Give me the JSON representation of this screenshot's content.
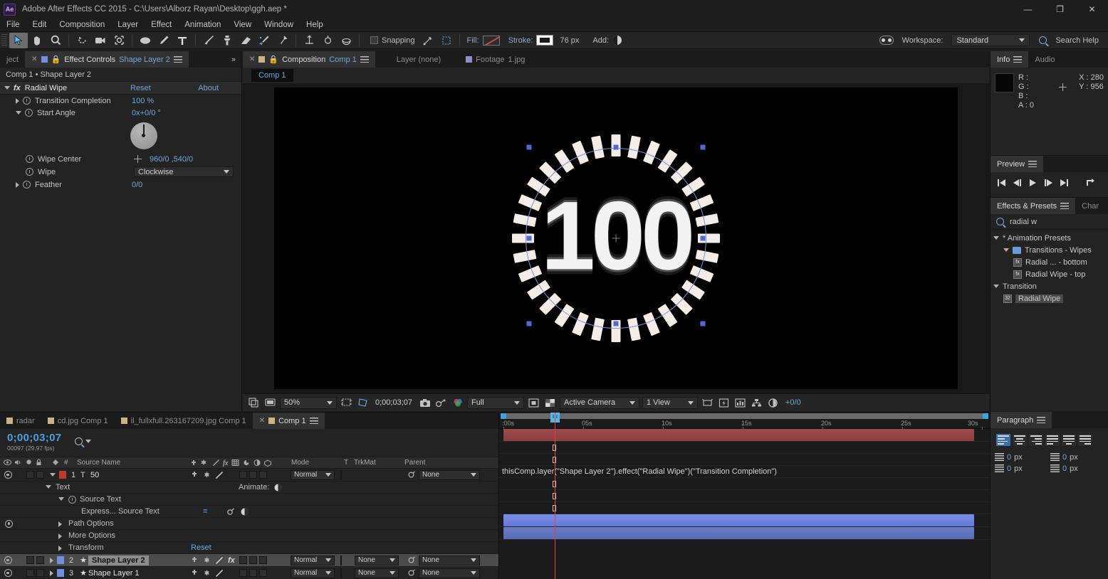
{
  "titlebar": {
    "logo": "Ae",
    "title": "Adobe After Effects CC 2015 - C:\\Users\\Alborz Rayan\\Desktop\\ggh.aep *",
    "minimize": "—",
    "maximize": "❐",
    "close": "✕"
  },
  "menu": [
    "File",
    "Edit",
    "Composition",
    "Layer",
    "Effect",
    "Animation",
    "View",
    "Window",
    "Help"
  ],
  "toolbar": {
    "snapping_label": "Snapping",
    "fill_label": "Fill:",
    "stroke_label": "Stroke:",
    "stroke_width": "76 px",
    "add_label": "Add:",
    "workspace_label": "Workspace:",
    "workspace_value": "Standard",
    "search_help": "Search Help"
  },
  "effect_controls": {
    "tab_project": "ject",
    "tab_title": "Effect Controls",
    "tab_subject": "Shape Layer 2",
    "breadcrumb": "Comp 1 • Shape Layer 2",
    "effect_name": "Radial Wipe",
    "reset": "Reset",
    "about": "About",
    "properties": [
      {
        "label": "Transition Completion",
        "value": "100 %"
      },
      {
        "label": "Start Angle",
        "value": "0x+0/0 °"
      },
      {
        "label": "Wipe Center",
        "value": "960/0 ,540/0"
      },
      {
        "label": "Wipe",
        "value": "Clockwise"
      },
      {
        "label": "Feather",
        "value": "0/0"
      }
    ]
  },
  "viewer": {
    "tabs": [
      {
        "label": "Composition",
        "value": "Comp 1",
        "active": true
      },
      {
        "label": "Layer (none)",
        "value": "",
        "active": false
      },
      {
        "label": "Footage",
        "value": "1.jpg",
        "active": false
      }
    ],
    "subtab": "Comp 1",
    "canvas_text": "100",
    "bottom": {
      "zoom": "50%",
      "time": "0;00;03;07",
      "quality": "Full",
      "camera": "Active Camera",
      "views": "1 View",
      "exposure": "+0/0"
    }
  },
  "info": {
    "tab": "Info",
    "tab2": "Audio",
    "r": "R :",
    "g": "G :",
    "b": "B :",
    "a": "A : 0",
    "x": "X : 280",
    "y": "Y : 956"
  },
  "preview": {
    "tab": "Preview"
  },
  "effects_presets": {
    "tab": "Effects & Presets",
    "tab2": "Char",
    "search_value": "radial w",
    "tree": [
      {
        "label": "* Animation Presets",
        "type": "group",
        "indent": 0
      },
      {
        "label": "Transitions - Wipes",
        "type": "folder",
        "indent": 1
      },
      {
        "label": "Radial ... - bottom",
        "type": "preset",
        "indent": 2
      },
      {
        "label": "Radial Wipe - top",
        "type": "preset",
        "indent": 2
      },
      {
        "label": "Transition",
        "type": "group",
        "indent": 0
      },
      {
        "label": "Radial Wipe",
        "type": "effect",
        "indent": 1,
        "selected": true
      }
    ]
  },
  "timeline": {
    "tabs": [
      {
        "label": "radar",
        "active": false
      },
      {
        "label": "cd.jpg Comp 1",
        "active": false
      },
      {
        "label": "il_fullxfull.263167209.jpg Comp 1",
        "active": false
      },
      {
        "label": "Comp 1",
        "active": true
      }
    ],
    "current_time": "0;00;03;07",
    "frame_info": "00097 (29.97 fps)",
    "columns": {
      "num": "#",
      "source_name": "Source Name",
      "mode": "Mode",
      "t": "T",
      "trkmat": "TrkMat",
      "parent": "Parent"
    },
    "layers": [
      {
        "num": "1",
        "name": "50",
        "mode": "Normal",
        "trkmat": "",
        "parent": "None",
        "color": "#c0392b",
        "selected": false
      },
      {
        "num": "2",
        "name": "Shape Layer 2",
        "mode": "Normal",
        "trkmat": "None",
        "parent": "None",
        "color": "#6f8fe0",
        "selected": true
      },
      {
        "num": "3",
        "name": "Shape Layer 1",
        "mode": "Normal",
        "trkmat": "None",
        "parent": "None",
        "color": "#6f8fe0",
        "selected": false
      }
    ],
    "properties": [
      {
        "label": "Text",
        "extra": "Animate:",
        "indent": 1
      },
      {
        "label": "Source Text",
        "extra": "",
        "indent": 2
      },
      {
        "label": "Express... Source Text",
        "extra": "",
        "indent": 3
      },
      {
        "label": "Path Options",
        "extra": "",
        "indent": 2
      },
      {
        "label": "More Options",
        "extra": "",
        "indent": 2
      },
      {
        "label": "Transform",
        "extra": "Reset",
        "indent": 2
      }
    ],
    "expression": "thisComp.layer(\"Shape Layer 2\").effect(\"Radial Wipe\")(\"Transition Completion\")",
    "ruler_ticks": [
      ":00s",
      "05s",
      "10s",
      "15s",
      "20s",
      "25s",
      "30s"
    ]
  },
  "paragraph": {
    "tab": "Paragraph",
    "fields": [
      {
        "value": "0",
        "unit": "px"
      },
      {
        "value": "0",
        "unit": "px"
      },
      {
        "value": "0",
        "unit": "px"
      },
      {
        "value": "0",
        "unit": "px"
      }
    ]
  }
}
